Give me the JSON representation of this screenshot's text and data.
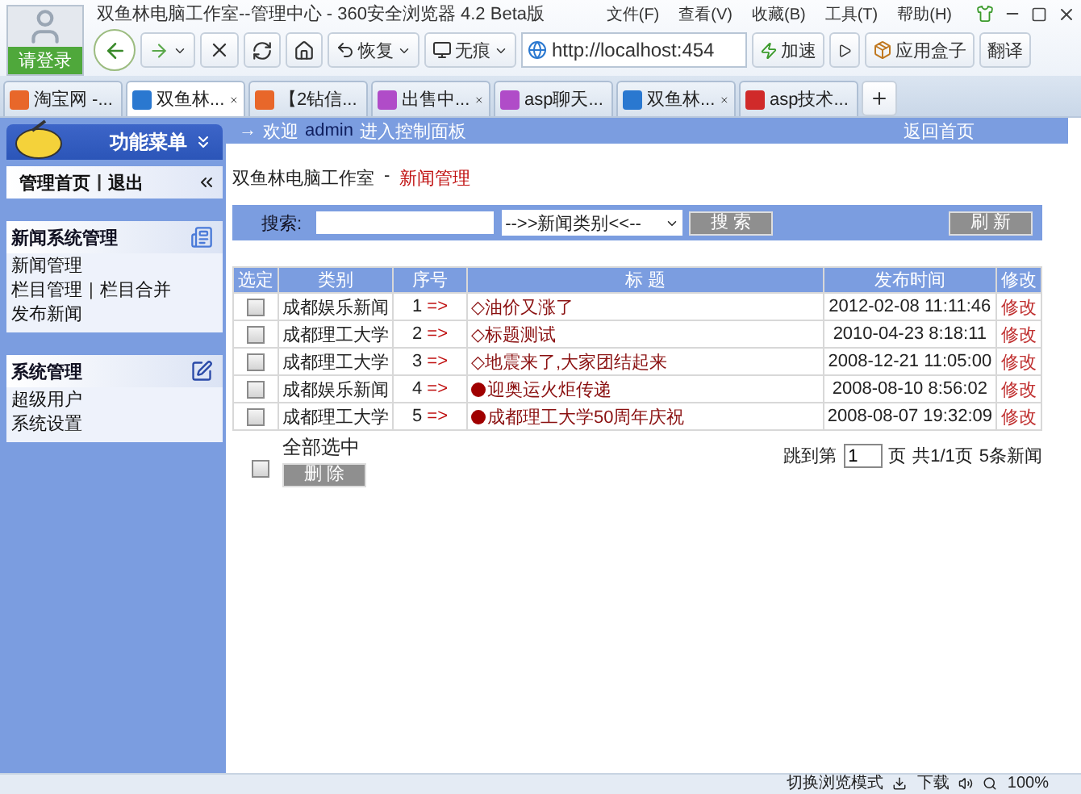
{
  "window": {
    "title": "双鱼林电脑工作室--管理中心 - 360安全浏览器 4.2 Beta版",
    "login": "请登录",
    "menu": [
      "文件(F)",
      "查看(V)",
      "收藏(B)",
      "工具(T)",
      "帮助(H)"
    ]
  },
  "toolbar": {
    "restore": "恢复",
    "incognito": "无痕",
    "address": "http://localhost:454",
    "accelerate": "加速",
    "appbox": "应用盒子",
    "translate": "翻译"
  },
  "tabs": [
    {
      "label": "淘宝网 -...",
      "selected": false,
      "color": "#e8672a"
    },
    {
      "label": "双鱼林...",
      "selected": true,
      "color": "#2a78d0"
    },
    {
      "label": "【2钻信...",
      "selected": false,
      "color": "#e8672a"
    },
    {
      "label": "出售中...",
      "selected": false,
      "color": "#b04cc8"
    },
    {
      "label": "asp聊天...",
      "selected": false,
      "color": "#b04cc8"
    },
    {
      "label": "双鱼林...",
      "selected": false,
      "color": "#2a78d0"
    },
    {
      "label": "asp技术...",
      "selected": false,
      "color": "#d02a2a"
    }
  ],
  "sidebar": {
    "header": "功能菜单",
    "top_links": {
      "home": "管理首页",
      "separator": "|",
      "logout": "退出"
    },
    "sections": [
      {
        "title": "新闻系统管理",
        "kind": "news",
        "rows": [
          [
            {
              "kind": "link",
              "text": "新闻管理"
            }
          ],
          [
            {
              "kind": "link",
              "text": "栏目管理"
            },
            {
              "kind": "separator",
              "text": "|"
            },
            {
              "kind": "link",
              "text": "栏目合并"
            }
          ],
          [
            {
              "kind": "link",
              "text": "发布新闻"
            }
          ]
        ]
      },
      {
        "title": "系统管理",
        "kind": "system",
        "rows": [
          [
            {
              "kind": "link",
              "text": "超级用户"
            }
          ],
          [
            {
              "kind": "link",
              "text": "系统设置"
            }
          ]
        ]
      }
    ]
  },
  "welcome": {
    "arrow": "→",
    "greeting": "欢迎",
    "user": "admin",
    "text": "进入控制面板",
    "home_link": "返回首页"
  },
  "breadcrumb": {
    "site": "双鱼林电脑工作室",
    "separator": "-",
    "page": "新闻管理"
  },
  "search": {
    "label": "搜索:",
    "category": "-->>新闻类别<<--",
    "search_button": "搜 索",
    "refresh_button": "刷 新"
  },
  "table": {
    "columns": [
      "选定",
      "类别",
      "序号",
      "标 题",
      "发布时间",
      "修改"
    ],
    "rows": [
      {
        "checked": false,
        "category": "成都娱乐新闻",
        "index": "1",
        "arrow": "=>",
        "kind": "plain",
        "title": "◇油价又涨了",
        "time": "2012-02-08 11:11:46",
        "edit": "修改"
      },
      {
        "checked": false,
        "category": "成都理工大学",
        "index": "2",
        "arrow": "=>",
        "kind": "plain",
        "title": "◇标题测试",
        "time": "2010-04-23 8:18:11",
        "edit": "修改"
      },
      {
        "checked": false,
        "category": "成都理工大学",
        "index": "3",
        "arrow": "=>",
        "kind": "plain",
        "title": "◇地震来了,大家团结起来",
        "time": "2008-12-21 11:05:00",
        "edit": "修改"
      },
      {
        "checked": false,
        "category": "成都娱乐新闻",
        "index": "4",
        "arrow": "=>",
        "kind": "hot",
        "title": "迎奥运火炬传递",
        "time": "2008-08-10 8:56:02",
        "edit": "修改"
      },
      {
        "checked": false,
        "category": "成都理工大学",
        "index": "5",
        "arrow": "=>",
        "kind": "hot",
        "title": "成都理工大学50周年庆祝",
        "time": "2008-08-07 19:32:09",
        "edit": "修改"
      }
    ]
  },
  "footer": {
    "select_all": "全部选中",
    "select_all_checked": false,
    "delete_button": "删 除",
    "jump_label": "跳到第",
    "page_value": "1",
    "page_unit": "页",
    "page_info": "共1/1页",
    "count": "5条新闻"
  },
  "status_bar": {
    "mode": "切换浏览模式",
    "download": "下载",
    "zoom": "100%"
  }
}
